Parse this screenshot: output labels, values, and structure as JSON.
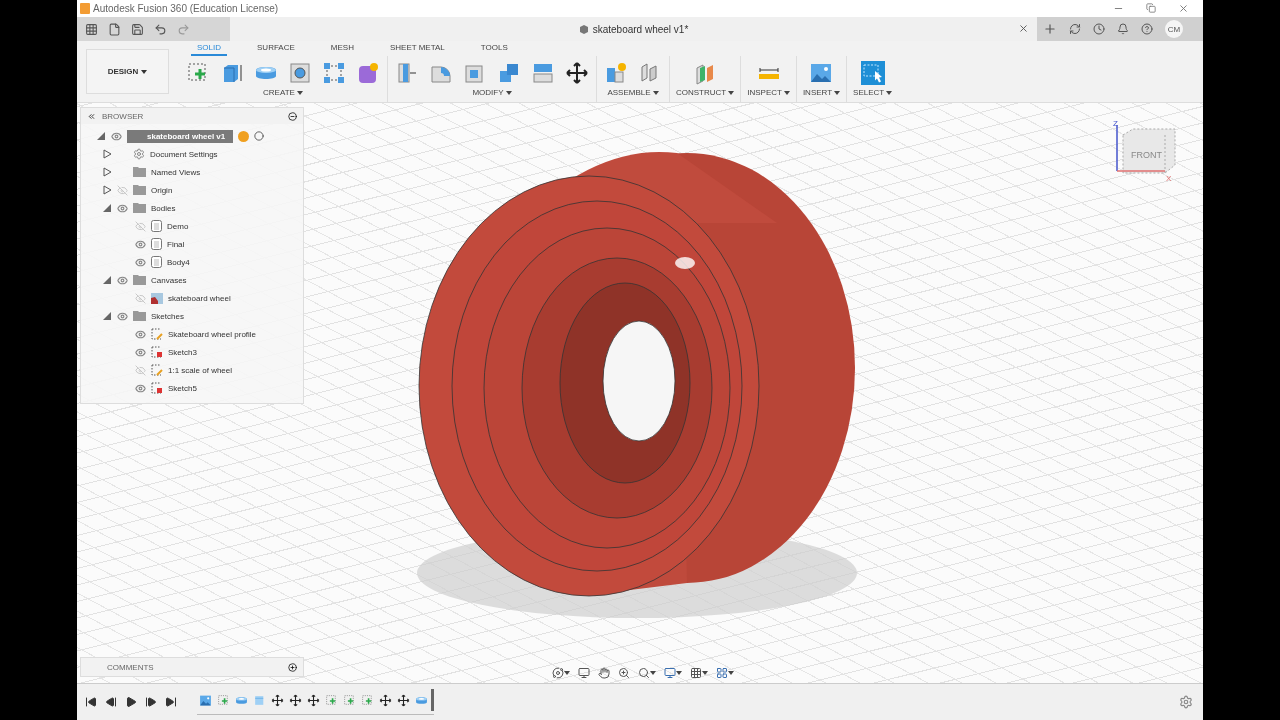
{
  "window": {
    "title": "Autodesk Fusion 360 (Education License)"
  },
  "document_tab": {
    "title": "skateboard wheel v1*"
  },
  "user": {
    "initials": "CM"
  },
  "workspace": {
    "label": "DESIGN"
  },
  "ribbon_tabs": [
    {
      "label": "SOLID",
      "selected": true
    },
    {
      "label": "SURFACE",
      "selected": false
    },
    {
      "label": "MESH",
      "selected": false
    },
    {
      "label": "SHEET METAL",
      "selected": false
    },
    {
      "label": "TOOLS",
      "selected": false
    }
  ],
  "tool_groups": [
    {
      "label": "CREATE",
      "tools": [
        {
          "kind": "sketch"
        },
        {
          "kind": "extrude"
        },
        {
          "kind": "revolve"
        },
        {
          "kind": "hole"
        },
        {
          "kind": "pattern"
        },
        {
          "kind": "form"
        }
      ]
    },
    {
      "label": "MODIFY",
      "tools": [
        {
          "kind": "press-pull"
        },
        {
          "kind": "fillet"
        },
        {
          "kind": "shell"
        },
        {
          "kind": "combine"
        },
        {
          "kind": "split"
        },
        {
          "kind": "move"
        }
      ]
    },
    {
      "label": "ASSEMBLE",
      "tools": [
        {
          "kind": "component"
        },
        {
          "kind": "joint"
        }
      ]
    },
    {
      "label": "CONSTRUCT",
      "tools": [
        {
          "kind": "plane"
        }
      ]
    },
    {
      "label": "INSPECT",
      "tools": [
        {
          "kind": "measure"
        }
      ]
    },
    {
      "label": "INSERT",
      "tools": [
        {
          "kind": "image"
        }
      ]
    },
    {
      "label": "SELECT",
      "tools": [
        {
          "kind": "select"
        }
      ]
    }
  ],
  "browser": {
    "title": "BROWSER",
    "root": {
      "label": "skateboard wheel v1",
      "expanded": true,
      "visible": true,
      "children": [
        {
          "label": "Document Settings",
          "kind": "settings",
          "expanded": false
        },
        {
          "label": "Named Views",
          "kind": "folder",
          "expanded": false
        },
        {
          "label": "Origin",
          "kind": "folder",
          "expanded": false,
          "visible": false
        },
        {
          "label": "Bodies",
          "kind": "folder",
          "expanded": true,
          "visible": true,
          "children": [
            {
              "label": "Demo",
              "kind": "body",
              "visible": false
            },
            {
              "label": "Final",
              "kind": "body",
              "visible": true
            },
            {
              "label": "Body4",
              "kind": "body",
              "visible": true
            }
          ]
        },
        {
          "label": "Canvases",
          "kind": "folder",
          "expanded": true,
          "visible": true,
          "children": [
            {
              "label": "skateboard wheel",
              "kind": "canvas",
              "visible": false
            }
          ]
        },
        {
          "label": "Sketches",
          "kind": "folder",
          "expanded": true,
          "visible": true,
          "children": [
            {
              "label": "Skateboard wheel profile",
              "kind": "sketch",
              "visible": true
            },
            {
              "label": "Sketch3",
              "kind": "locked-sketch",
              "visible": true
            },
            {
              "label": "1:1 scale of wheel",
              "kind": "sketch",
              "visible": false
            },
            {
              "label": "Sketch5",
              "kind": "locked-sketch",
              "visible": true
            }
          ]
        }
      ]
    }
  },
  "viewcube": {
    "face": "FRONT",
    "z_label": "Z",
    "x_label": "X"
  },
  "comments": {
    "title": "COMMENTS"
  },
  "timeline": {
    "features": [
      {
        "kind": "canvas"
      },
      {
        "kind": "sketch"
      },
      {
        "kind": "revolve"
      },
      {
        "kind": "body"
      },
      {
        "kind": "move"
      },
      {
        "kind": "move"
      },
      {
        "kind": "move"
      },
      {
        "kind": "sketch"
      },
      {
        "kind": "sketch"
      },
      {
        "kind": "sketch"
      },
      {
        "kind": "move"
      },
      {
        "kind": "move"
      },
      {
        "kind": "revolve"
      }
    ]
  }
}
